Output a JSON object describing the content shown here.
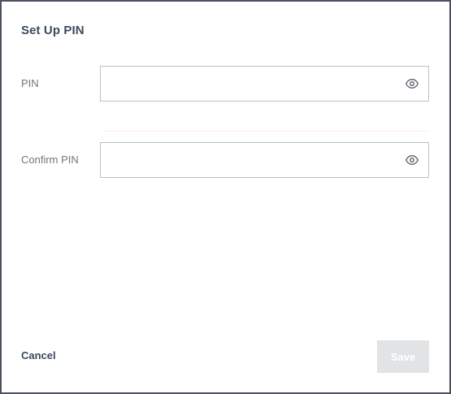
{
  "dialog": {
    "title": "Set Up PIN"
  },
  "fields": {
    "pin": {
      "label": "PIN",
      "value": "",
      "placeholder": "",
      "icon": "eye-icon"
    },
    "confirm_pin": {
      "label": "Confirm PIN",
      "value": "",
      "placeholder": "",
      "icon": "eye-icon"
    }
  },
  "actions": {
    "cancel_label": "Cancel",
    "save_label": "Save",
    "save_disabled": true
  },
  "colors": {
    "title": "#3c4a5e",
    "label": "#6f7780",
    "border": "#b8c2cc",
    "save_disabled_bg": "#e1e3e5"
  }
}
